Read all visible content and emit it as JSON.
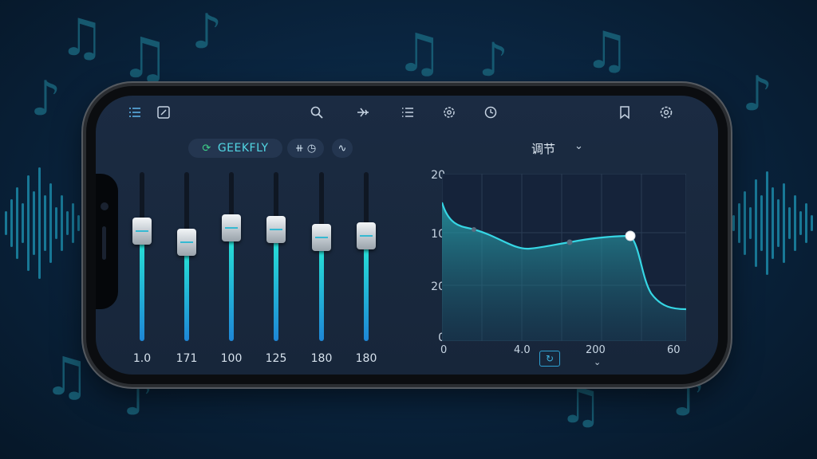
{
  "background_notes": [
    "♫",
    "♪",
    "♫",
    "♪",
    "♫",
    "♪",
    "♫",
    "♪",
    "♫",
    "♪",
    "♫",
    "♪"
  ],
  "toolbar": {
    "icons": [
      "menu-icon",
      "edit-icon",
      "search-icon",
      "airplane-icon",
      "list-icon",
      "settings-gear-icon",
      "clock-icon",
      "bookmark-icon",
      "settings-icon"
    ]
  },
  "preset": {
    "brand_label": "GEEKFLY",
    "brand_logo": "⟳"
  },
  "chips": {
    "mode_a": "⧺ ◷",
    "mode_b": "∿"
  },
  "sliders": {
    "labels": [
      "1.0",
      "171",
      "100",
      "125",
      "180",
      "180"
    ],
    "levels": [
      0.66,
      0.59,
      0.68,
      0.67,
      0.62,
      0.63
    ]
  },
  "graph": {
    "title": "调节",
    "y_ticks": [
      "20",
      "10",
      "20",
      "0"
    ],
    "x_ticks": [
      "0",
      "4.0",
      "200",
      "60"
    ],
    "reset_label": "↻",
    "accent": "#36d6e4"
  },
  "colors": {
    "accent": "#27e6d6",
    "fill_bottom": "#1e86d6"
  }
}
